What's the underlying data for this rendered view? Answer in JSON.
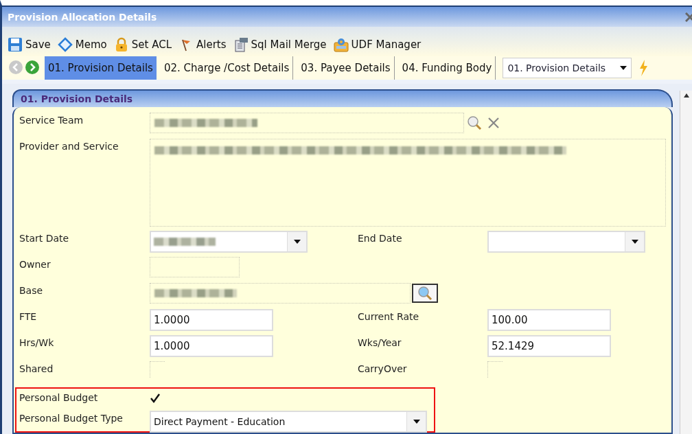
{
  "window": {
    "title": "Provision Allocation Details"
  },
  "toolbar": [
    {
      "kind": "save",
      "label": "Save"
    },
    {
      "kind": "memo",
      "label": "Memo"
    },
    {
      "kind": "lock",
      "label": "Set ACL"
    },
    {
      "kind": "flag",
      "label": "Alerts"
    },
    {
      "kind": "mail",
      "label": "Sql Mail Merge"
    },
    {
      "kind": "gear",
      "label": "UDF Manager"
    }
  ],
  "nav_tabs": [
    {
      "label": "01. Provision Details",
      "selected": true
    },
    {
      "label": "02. Charge /Cost Details",
      "selected": false
    },
    {
      "label": "03. Payee Details",
      "selected": false
    },
    {
      "label": "04. Funding Body",
      "selected": false
    }
  ],
  "section_select": {
    "value": "01. Provision Details"
  },
  "panel": {
    "title": "01. Provision Details"
  },
  "rows": [
    {
      "fields": [
        {
          "label": "Service Team",
          "kind": "lookup",
          "redacted": true
        }
      ]
    },
    {
      "fields": [
        {
          "label": "Provider and Service",
          "kind": "memo",
          "redacted": true
        }
      ]
    },
    {
      "fields": [
        {
          "label": "Start Date",
          "kind": "combo",
          "redacted": true
        },
        {
          "label": "End Date",
          "kind": "combo",
          "redacted": false
        }
      ]
    },
    {
      "fields": [
        {
          "label": "Owner",
          "kind": "short",
          "redacted": false
        }
      ]
    },
    {
      "fields": [
        {
          "label": "Base",
          "kind": "search",
          "redacted": true
        }
      ]
    },
    {
      "fields": [
        {
          "label": "FTE",
          "kind": "text",
          "value": "1.0000"
        },
        {
          "label": "Current Rate",
          "kind": "text",
          "value": "100.00"
        }
      ]
    },
    {
      "fields": [
        {
          "label": "Hrs/Wk",
          "kind": "text",
          "value": "1.0000"
        },
        {
          "label": "Wks/Year",
          "kind": "text",
          "value": "52.1429"
        }
      ]
    },
    {
      "fields": [
        {
          "label": "Shared",
          "kind": "check",
          "checked": false
        },
        {
          "label": "CarryOver",
          "kind": "check",
          "checked": false
        }
      ]
    }
  ],
  "highlighted_rows": [
    {
      "fields": [
        {
          "label": "Personal Budget",
          "kind": "check",
          "checked": true
        }
      ]
    },
    {
      "fields": [
        {
          "label": "Personal Budget Type",
          "kind": "wide_combo",
          "value": "Direct Payment - Education"
        }
      ]
    }
  ]
}
